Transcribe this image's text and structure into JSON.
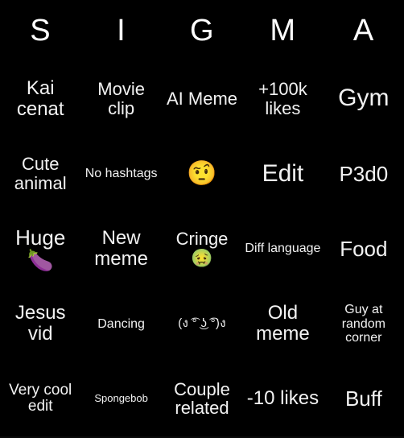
{
  "card": {
    "title": "SIGMA",
    "background_color": "#000000",
    "text_color": "#f2f2f2",
    "header_text_color": "#ffffff"
  },
  "header": {
    "letters": [
      {
        "label": "S"
      },
      {
        "label": "I"
      },
      {
        "label": "G"
      },
      {
        "label": "M"
      },
      {
        "label": "A"
      }
    ]
  },
  "grid": {
    "rows": [
      {
        "cells": [
          {
            "text": "Kai cenat",
            "size": "fs-lg"
          },
          {
            "text": "Movie clip",
            "size": "fs-md"
          },
          {
            "text": "AI Meme",
            "size": "fs-md"
          },
          {
            "text": "+100k likes",
            "size": "fs-md"
          },
          {
            "text": "Gym",
            "size": "fs-xxl"
          }
        ]
      },
      {
        "cells": [
          {
            "text": "Cute animal",
            "size": "fs-md"
          },
          {
            "text": "No hashtags",
            "size": "fs-xs"
          },
          {
            "text": "🤨",
            "size": "emoji",
            "is_emoji": true,
            "emoji_name": "face-with-raised-eyebrow"
          },
          {
            "text": "Edit",
            "size": "fs-xxl"
          },
          {
            "text": "P3d0",
            "size": "fs-xl"
          }
        ]
      },
      {
        "cells": [
          {
            "text": "Huge 🍆",
            "size": "fs-xl",
            "has_emoji": true,
            "emoji_name": "eggplant"
          },
          {
            "text": "New meme",
            "size": "fs-lg"
          },
          {
            "text": "Cringe 🤢",
            "size": "fs-md",
            "has_emoji": true,
            "emoji_name": "nauseated-face"
          },
          {
            "text": "Diff language",
            "size": "fs-xs"
          },
          {
            "text": "Food",
            "size": "fs-xl"
          }
        ]
      },
      {
        "cells": [
          {
            "text": "Jesus vid",
            "size": "fs-lg"
          },
          {
            "text": "Dancing",
            "size": "fs-xs"
          },
          {
            "text": "(ง ͡° ͜ʖ ͡°)ง",
            "size": "kaomoji",
            "is_kaomoji": true
          },
          {
            "text": "Old meme",
            "size": "fs-lg"
          },
          {
            "text": "Guy at random corner",
            "size": "fs-xs"
          }
        ]
      },
      {
        "cells": [
          {
            "text": "Very cool edit",
            "size": "fs-sm"
          },
          {
            "text": "Spongebob",
            "size": "fs-xxs"
          },
          {
            "text": "Couple related",
            "size": "fs-md"
          },
          {
            "text": "-10 likes",
            "size": "fs-lg"
          },
          {
            "text": "Buff",
            "size": "fs-xl"
          }
        ]
      }
    ]
  }
}
